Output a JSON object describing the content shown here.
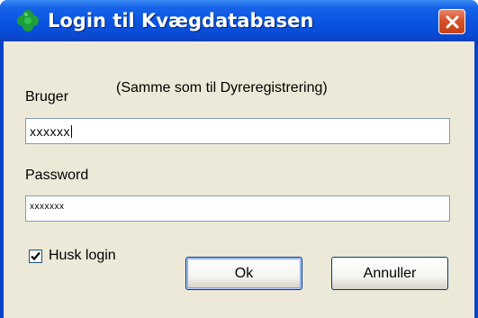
{
  "window": {
    "title": "Login til Kvægdatabasen",
    "title_icon": "green-clover-icon",
    "close_icon": "close-icon"
  },
  "form": {
    "note": "(Samme som til Dyreregistrering)",
    "user_label": "Bruger",
    "user_value": "xxxxxx",
    "password_label": "Password",
    "password_value": "xxxxxxx",
    "remember_label": "Husk login",
    "remember_checked": true
  },
  "buttons": {
    "ok_label": "Ok",
    "cancel_label": "Annuller"
  },
  "colors": {
    "titlebar": "#0a52e0",
    "client_background": "#ece9d8",
    "close_button": "#d9512a",
    "input_border": "#7f9db9"
  }
}
